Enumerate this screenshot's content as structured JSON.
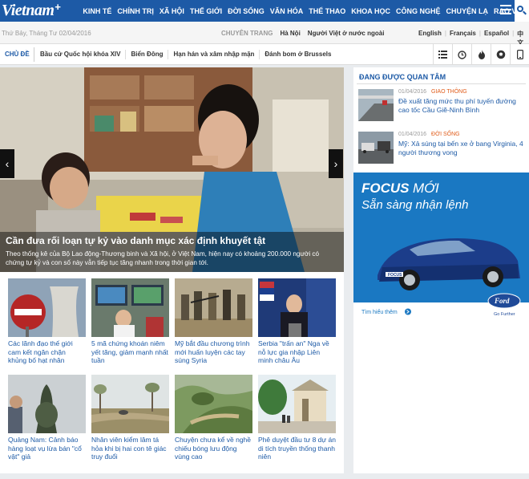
{
  "header": {
    "logo": "Vietnam",
    "logo_plus": "+",
    "nav": [
      "KINH TẾ",
      "CHÍNH TRỊ",
      "XÃ HỘI",
      "THẾ GIỚI",
      "ĐỜI SỐNG",
      "VĂN HÓA",
      "THỂ THAO",
      "KHOA HỌC",
      "CÔNG NGHỆ",
      "CHUYỆN LẠ",
      "RAO VẶT"
    ]
  },
  "subbar": {
    "date": "Thứ Bảy, Tháng Tư 02/04/2016",
    "label": "CHUYÊN TRANG",
    "links": [
      "Hà Nội",
      "Người Việt ở nước ngoài"
    ],
    "langs": [
      "English",
      "Français",
      "Español",
      "中文"
    ]
  },
  "topics": {
    "label": "CHỦ ĐỀ",
    "items": [
      "Bầu cử Quốc hội khóa XIV",
      "Biển Đông",
      "Hạn hán và xâm nhập mặn",
      "Đánh bom ở Brussels"
    ]
  },
  "hero": {
    "title": "Cần đưa rối loạn tự kỷ vào danh mục xác định khuyết tật",
    "desc": "Theo thống kê của Bộ Lao động-Thương binh và Xã hội, ở Việt Nam, hiện nay có khoảng 200.000 người có chứng tự kỷ và con số này vẫn tiếp tục tăng nhanh trong thời gian tới."
  },
  "grid": [
    {
      "caption": "Các lãnh đạo thế giới cam kết ngăn chặn khủng bố hạt nhân"
    },
    {
      "caption": "5 mã chứng khoán niêm yết tăng, giảm mạnh nhất tuần"
    },
    {
      "caption": "Mỹ bắt đầu chương trình mới huấn luyện các tay súng Syria"
    },
    {
      "caption": "Serbia \"trấn an\" Nga về nỗ lực gia nhập Liên minh châu Âu"
    },
    {
      "caption": "Quảng Nam: Cảnh báo hàng loạt vụ lừa bán \"cổ vật\" giả"
    },
    {
      "caption": "Nhân viên kiểm lâm tá hỏa khi bị hai con tê giác truy đuổi"
    },
    {
      "caption": "Chuyện chưa kể về nghề chiếu bóng lưu động vùng cao"
    },
    {
      "caption": "Phê duyệt đầu tư 8 dự án di tích truyền thống thanh niên"
    }
  ],
  "sidebar": {
    "title": "ĐANG ĐƯỢC QUAN TÂM",
    "items": [
      {
        "date": "01/04/2016",
        "category": "GIAO THÔNG",
        "title": "Đề xuất tăng mức thu phí tuyến đường cao tốc Cầu Giẽ-Ninh Bình"
      },
      {
        "date": "01/04/2016",
        "category": "ĐỜI SỐNG",
        "title": "Mỹ: Xả súng tại bến xe ở bang Virginia, 4 người thương vong"
      }
    ]
  },
  "ad": {
    "headline_1": "FOCUS",
    "headline_2": "MỚI",
    "subline": "Sẵn sàng nhận lệnh",
    "cta": "Tìm hiểu thêm",
    "brand": "Ford",
    "tagline": "Go Further",
    "plate": "FOCUS"
  },
  "colors": {
    "brand_blue": "#1d5aa6",
    "accent_orange": "#e05c1a",
    "ad_blue": "#1a78c2"
  }
}
